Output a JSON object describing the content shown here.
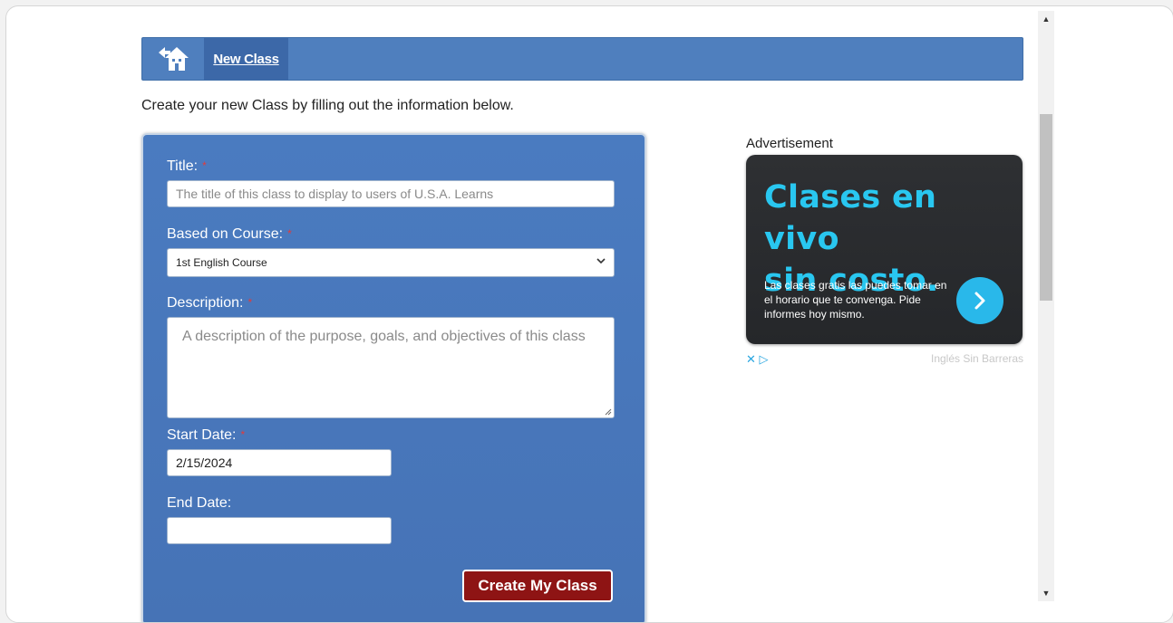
{
  "nav": {
    "home_icon": "home-back-icon",
    "tab_label": "New Class"
  },
  "intro_text": "Create your new Class by filling out the information below.",
  "form": {
    "title_label": "Title:",
    "title_placeholder": "The title of this class to display to users of U.S.A. Learns",
    "course_label": "Based on Course:",
    "course_value": "1st English Course",
    "description_label": "Description:",
    "description_placeholder": "A description of the purpose, goals, and objectives of this class",
    "start_label": "Start Date:",
    "start_value": "2/15/2024",
    "end_label": "End Date:",
    "end_value": "",
    "required_mark": "*",
    "submit_label": "Create My Class"
  },
  "ad": {
    "label": "Advertisement",
    "headline_line1": "Clases en vivo",
    "headline_line2": "sin costo.",
    "body": "Las clases gratis las puedes tomar en el horario que te convenga. Pide informes hoy mismo.",
    "choices": "✕ ▷",
    "sponsor": "Inglés Sin Barreras"
  },
  "colors": {
    "navbar": "#4f7fbe",
    "panel": "#4a7bc0",
    "button": "#8e1414",
    "ad_accent": "#29c7f0",
    "required": "#e23b3b"
  }
}
